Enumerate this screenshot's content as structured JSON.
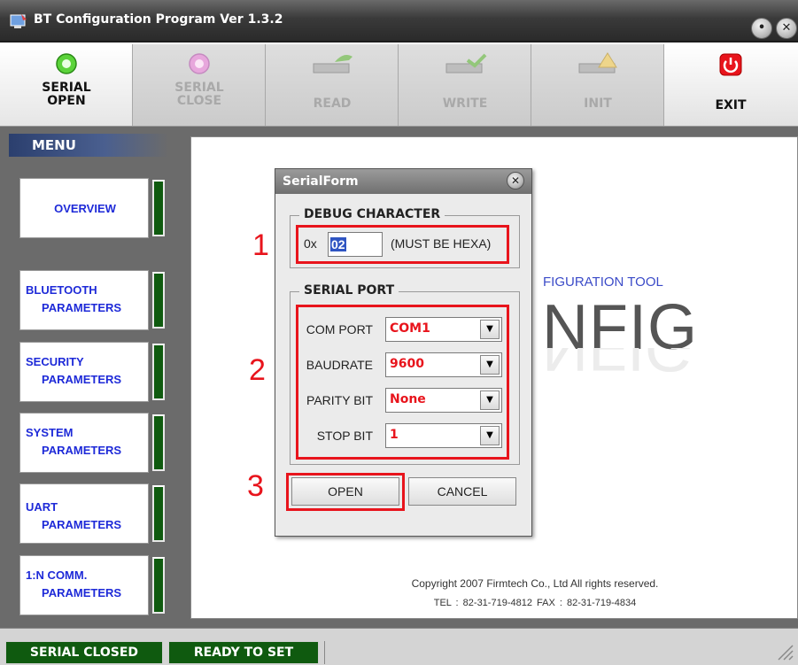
{
  "window": {
    "title": "BT Configuration Program Ver 1.3.2",
    "min_glyph": "•",
    "close_glyph": "✕"
  },
  "toolbar": [
    {
      "id": "serial_open",
      "label": "SERIAL\nOPEN",
      "icon": "green-circle-icon",
      "enabled": true
    },
    {
      "id": "serial_close",
      "label": "SERIAL\nCLOSE",
      "icon": "pink-circle-icon",
      "enabled": false
    },
    {
      "id": "read",
      "label": "READ",
      "icon": "chip-read-icon",
      "enabled": false
    },
    {
      "id": "write",
      "label": "WRITE",
      "icon": "chip-write-icon",
      "enabled": false
    },
    {
      "id": "init",
      "label": "INIT",
      "icon": "chip-warning-icon",
      "enabled": false
    },
    {
      "id": "exit",
      "label": "EXIT",
      "icon": "power-icon",
      "enabled": true
    }
  ],
  "menu": {
    "header": "MENU",
    "items": [
      {
        "label": "OVERVIEW"
      },
      {
        "label": "BLUETOOTH\n     PARAMETERS"
      },
      {
        "label": "SECURITY\n     PARAMETERS"
      },
      {
        "label": "SYSTEM\n     PARAMETERS"
      },
      {
        "label": "UART\n     PARAMETERS"
      },
      {
        "label": "1:N COMM.\n     PARAMETERS"
      }
    ]
  },
  "main": {
    "tool_label": "FIGURATION TOOL",
    "logo": "NFIG",
    "copyright": "Copyright 2007 Firmtech Co., Ltd All rights reserved.",
    "contact": "TEL : 82-31-719-4812    FAX : 82-31-719-4834"
  },
  "dialog": {
    "title": "SerialForm",
    "close_glyph": "✕",
    "debug_group": "DEBUG CHARACTER",
    "prefix": "0x",
    "debug_value": "02",
    "hint": "(MUST BE HEXA)",
    "serial_group": "SERIAL PORT",
    "rows": [
      {
        "label": "COM PORT",
        "value": "COM1"
      },
      {
        "label": "BAUDRATE",
        "value": "9600"
      },
      {
        "label": "PARITY BIT",
        "value": "None"
      },
      {
        "label": "STOP BIT",
        "value": "1"
      }
    ],
    "open": "OPEN",
    "cancel": "CANCEL",
    "dropdown_glyph": "▼"
  },
  "annotations": [
    "1",
    "2",
    "3"
  ],
  "status": {
    "serial": "SERIAL CLOSED",
    "ready": "READY TO SET"
  },
  "colors": {
    "highlight": "#e8141c",
    "menu_link": "#1e2ad8",
    "status_green": "#0f5a0f"
  }
}
